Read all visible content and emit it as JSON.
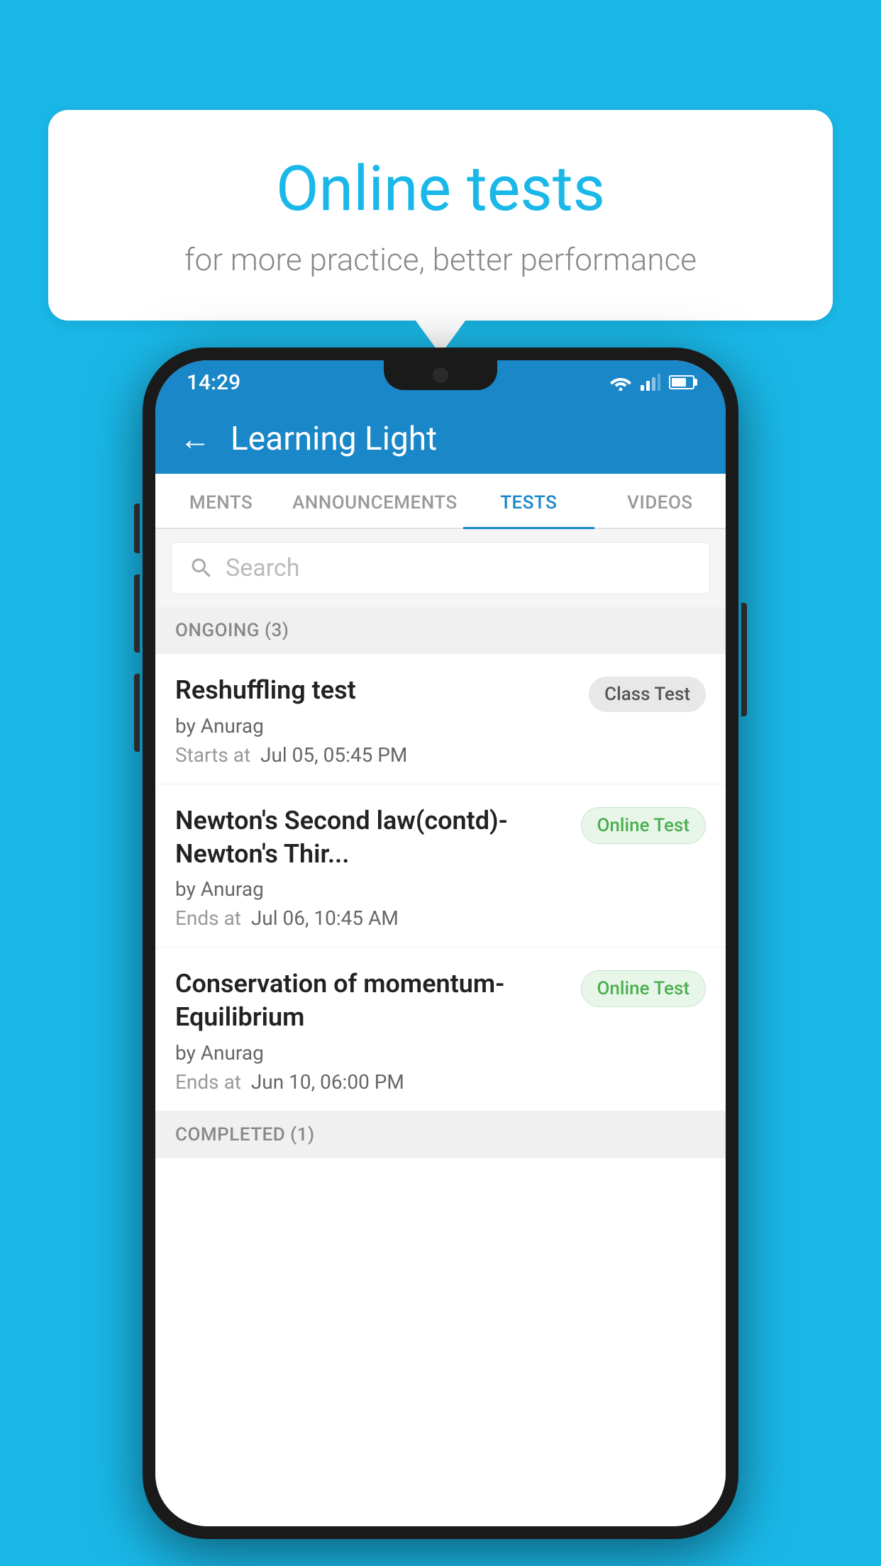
{
  "background": {
    "color": "#1ab8e8"
  },
  "speech_bubble": {
    "title": "Online tests",
    "subtitle": "for more practice, better performance"
  },
  "phone": {
    "status_bar": {
      "time": "14:29"
    },
    "header": {
      "title": "Learning Light"
    },
    "tabs": [
      {
        "label": "MENTS",
        "active": false
      },
      {
        "label": "ANNOUNCEMENTS",
        "active": false
      },
      {
        "label": "TESTS",
        "active": true
      },
      {
        "label": "VIDEOS",
        "active": false
      }
    ],
    "search": {
      "placeholder": "Search"
    },
    "ongoing_section": {
      "label": "ONGOING (3)"
    },
    "tests": [
      {
        "name": "Reshuffling test",
        "author": "by Anurag",
        "time_label": "Starts at",
        "time_value": "Jul 05, 05:45 PM",
        "badge_text": "Class Test",
        "badge_type": "class"
      },
      {
        "name": "Newton's Second law(contd)-Newton's Thir...",
        "author": "by Anurag",
        "time_label": "Ends at",
        "time_value": "Jul 06, 10:45 AM",
        "badge_text": "Online Test",
        "badge_type": "online"
      },
      {
        "name": "Conservation of momentum-Equilibrium",
        "author": "by Anurag",
        "time_label": "Ends at",
        "time_value": "Jun 10, 06:00 PM",
        "badge_text": "Online Test",
        "badge_type": "online"
      }
    ],
    "completed_section": {
      "label": "COMPLETED (1)"
    }
  }
}
